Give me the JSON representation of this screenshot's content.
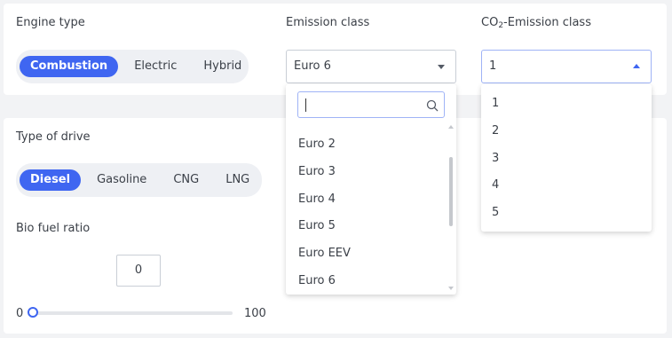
{
  "engine": {
    "label": "Engine type",
    "options": [
      "Combustion",
      "Electric",
      "Hybrid"
    ],
    "selected": "Combustion"
  },
  "emission": {
    "label": "Emission class",
    "value": "Euro 6",
    "search_value": "",
    "options": [
      "Euro 2",
      "Euro 3",
      "Euro 4",
      "Euro 5",
      "Euro EEV",
      "Euro 6"
    ]
  },
  "co2": {
    "label_prefix": "CO",
    "label_sub": "2",
    "label_suffix": "-Emission class",
    "value": "1",
    "options": [
      "1",
      "2",
      "3",
      "4",
      "5"
    ]
  },
  "drive": {
    "label": "Type of drive",
    "options": [
      "Diesel",
      "Gasoline",
      "CNG",
      "LNG"
    ],
    "selected": "Diesel"
  },
  "biofuel": {
    "label": "Bio fuel ratio",
    "value": "0",
    "min_label": "0",
    "max_label": "100"
  },
  "colors": {
    "accent": "#3f66f1",
    "background": "#f2f3f5",
    "card": "#ffffff"
  }
}
